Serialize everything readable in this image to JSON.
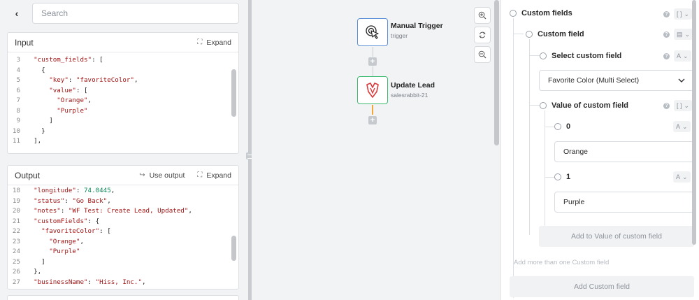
{
  "left": {
    "back_icon": "chevron-left-icon",
    "search_placeholder": "Search",
    "input": {
      "title": "Input",
      "expand_label": "Expand",
      "lines": [
        {
          "n": "3",
          "html": "  <span class=\"s\">\"custom_fields\"</span>: ["
        },
        {
          "n": "4",
          "html": "    {"
        },
        {
          "n": "5",
          "html": "      <span class=\"s\">\"key\"</span>: <span class=\"s\">\"favoriteColor\"</span>,"
        },
        {
          "n": "6",
          "html": "      <span class=\"s\">\"value\"</span>: ["
        },
        {
          "n": "7",
          "html": "        <span class=\"s\">\"Orange\"</span>,"
        },
        {
          "n": "8",
          "html": "        <span class=\"s\">\"Purple\"</span>"
        },
        {
          "n": "9",
          "html": "      ]"
        },
        {
          "n": "10",
          "html": "    }"
        },
        {
          "n": "11",
          "html": "  ],"
        }
      ]
    },
    "output": {
      "title": "Output",
      "use_output_label": "Use output",
      "expand_label": "Expand",
      "lines": [
        {
          "n": "18",
          "html": "  <span class=\"s\">\"longitude\"</span>: <span class=\"n\">74.0445</span>,"
        },
        {
          "n": "19",
          "html": "  <span class=\"s\">\"status\"</span>: <span class=\"s\">\"Go Back\"</span>,"
        },
        {
          "n": "20",
          "html": "  <span class=\"s\">\"notes\"</span>: <span class=\"s\">\"WF Test: Create Lead, Updated\"</span>,"
        },
        {
          "n": "21",
          "html": "  <span class=\"s\">\"customFields\"</span>: {"
        },
        {
          "n": "22",
          "html": "    <span class=\"s\">\"favoriteColor\"</span>: ["
        },
        {
          "n": "23",
          "html": "      <span class=\"s\">\"Orange\"</span>,"
        },
        {
          "n": "24",
          "html": "      <span class=\"s\">\"Purple\"</span>"
        },
        {
          "n": "25",
          "html": "    ]"
        },
        {
          "n": "26",
          "html": "  },"
        },
        {
          "n": "27",
          "html": "  <span class=\"s\">\"businessName\"</span>: <span class=\"s\">\"Hiss, Inc.\"</span>,"
        }
      ]
    }
  },
  "canvas": {
    "trigger": {
      "title": "Manual Trigger",
      "subtitle": "trigger",
      "icon": "cursor-click-icon"
    },
    "action": {
      "title": "Update Lead",
      "subtitle": "salesrabbit-21",
      "icon": "salesrabbit-logo-icon"
    },
    "zoom": [
      "zoom-in-icon",
      "reset-icon",
      "zoom-out-icon"
    ]
  },
  "right": {
    "custom_fields_label": "Custom fields",
    "custom_field_label": "Custom field",
    "select_custom_field_label": "Select custom field",
    "selected_value": "Favorite Color (Multi Select)",
    "value_label": "Value of custom field",
    "item0_label": "0",
    "item0_value": "Orange",
    "item1_label": "1",
    "item1_value": "Purple",
    "add_value_label": "Add to Value of custom field",
    "hint": "Add more than one Custom field",
    "add_custom_field_label": "Add Custom field",
    "chip_array": "[ ]",
    "chip_object": "▤",
    "chip_text": "A",
    "help": "?"
  }
}
